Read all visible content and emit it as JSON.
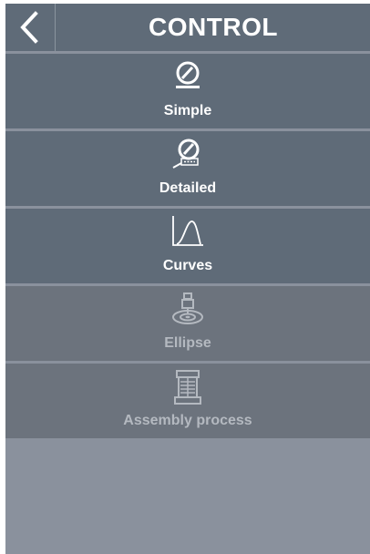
{
  "header": {
    "title": "CONTROL",
    "back_icon": "chevron-left-icon"
  },
  "menu": {
    "items": [
      {
        "label": "Simple",
        "icon": "gauge-icon",
        "enabled": true
      },
      {
        "label": "Detailed",
        "icon": "gauge-magnifier-icon",
        "enabled": true
      },
      {
        "label": "Curves",
        "icon": "curve-graph-icon",
        "enabled": true
      },
      {
        "label": "Ellipse",
        "icon": "ellipse-target-icon",
        "enabled": false
      },
      {
        "label": "Assembly process",
        "icon": "assembly-clamp-icon",
        "enabled": false
      }
    ]
  },
  "colors": {
    "header_bg": "#5f6b78",
    "item_bg": "#5f6b78",
    "item_disabled_bg": "#6c737d",
    "panel_bg": "#8a919d",
    "text": "#ffffff",
    "text_disabled": "#b4b9c0"
  }
}
